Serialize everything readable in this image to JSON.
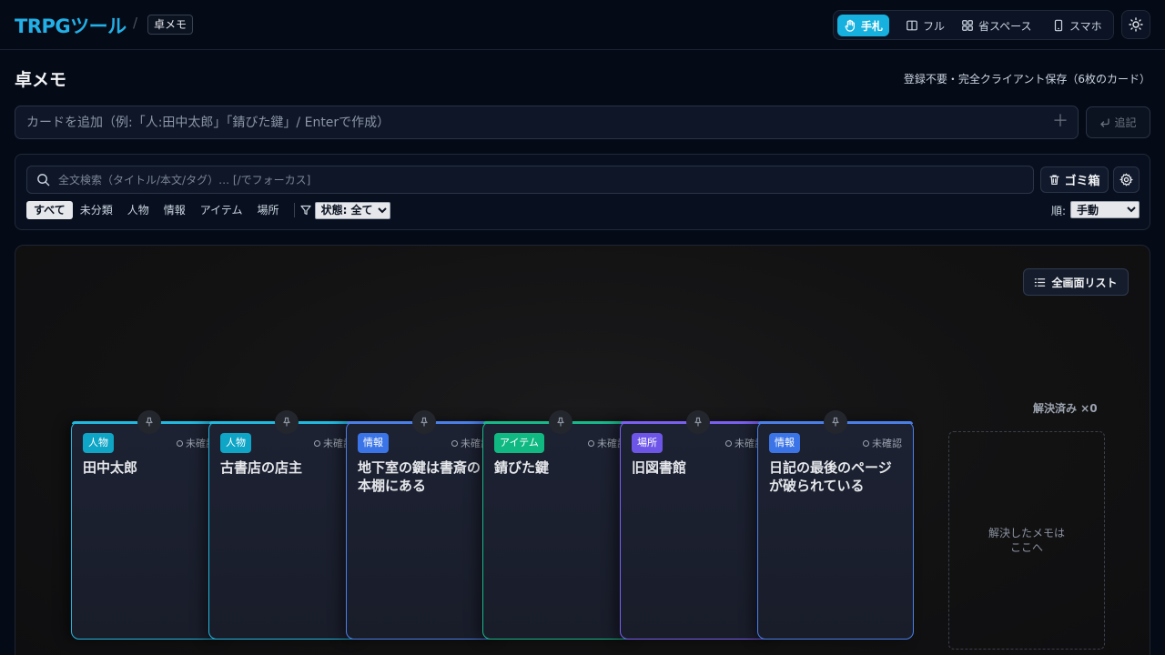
{
  "header": {
    "brand": "TRPGツール",
    "separator": "/",
    "crumb": "卓メモ",
    "modes": [
      {
        "label": "手札",
        "icon": "hand-icon",
        "active": true
      },
      {
        "label": "フル",
        "icon": "columns-icon",
        "active": false
      },
      {
        "label": "省スペース",
        "icon": "grid-icon",
        "active": false
      },
      {
        "label": "スマホ",
        "icon": "phone-icon",
        "active": false
      }
    ],
    "theme_icon": "sun-icon"
  },
  "page": {
    "title": "卓メモ",
    "subtitle": "登録不要・完全クライアント保存（6枚のカード）"
  },
  "add": {
    "placeholder": "カードを追加（例:「人:田中太郎」「錆びた鍵」/ Enterで作成）",
    "plus_icon": "plus-icon",
    "button_label": "追記",
    "button_icon": "enter-icon"
  },
  "filters": {
    "search_placeholder": "全文検索（タイトル/本文/タグ）… [/でフォーカス]",
    "trash_label": "ゴミ箱",
    "tabs": [
      "すべて",
      "未分類",
      "人物",
      "情報",
      "アイテム",
      "場所"
    ],
    "active_tab": "すべて",
    "status_select": "状態: 全て",
    "sort_label": "順:",
    "sort_select": "手動"
  },
  "board": {
    "fullscreen_label": "全画面リスト",
    "solved_label": "解決済み ×0",
    "solved_drop_line1": "解決したメモは",
    "solved_drop_line2": "ここへ",
    "cards": [
      {
        "tag": "人物",
        "tag_color": "#0ea5c6",
        "accent": "#22b8e0",
        "status": "未確認",
        "title": "田中太郎"
      },
      {
        "tag": "人物",
        "tag_color": "#0ea5c6",
        "accent": "#22b8e0",
        "status": "未確認",
        "title": "古書店の店主"
      },
      {
        "tag": "情報",
        "tag_color": "#3b74e6",
        "accent": "#4a7fe8",
        "status": "未確認",
        "title": "地下室の鍵は書斎の本棚にある"
      },
      {
        "tag": "アイテム",
        "tag_color": "#10b981",
        "accent": "#18b889",
        "status": "未確認",
        "title": "錆びた鍵"
      },
      {
        "tag": "場所",
        "tag_color": "#6d55e8",
        "accent": "#7a5ff0",
        "status": "未確認",
        "title": "旧図書館"
      },
      {
        "tag": "情報",
        "tag_color": "#3b74e6",
        "accent": "#4a7fe8",
        "status": "未確認",
        "title": "日記の最後のページが破られている"
      }
    ]
  }
}
